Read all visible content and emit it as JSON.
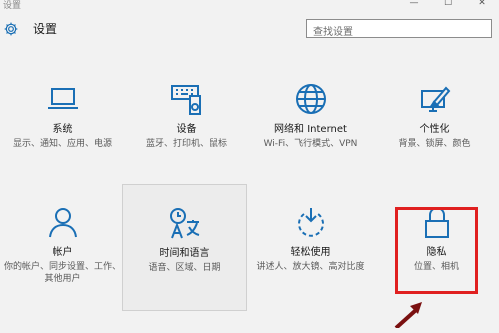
{
  "window": {
    "title": "设置",
    "controls": [
      "—",
      "☐",
      "✕"
    ]
  },
  "header": {
    "icon": "gear-icon",
    "title": "设置"
  },
  "search": {
    "placeholder": "查找设置"
  },
  "tiles": [
    {
      "icon": "laptop-icon",
      "name": "系统",
      "desc": "显示、通知、应用、电源"
    },
    {
      "icon": "keyboard-speaker-icon",
      "name": "设备",
      "desc": "蓝牙、打印机、鼠标"
    },
    {
      "icon": "globe-icon",
      "name": "网络和 Internet",
      "desc": "Wi-Fi、飞行模式、VPN"
    },
    {
      "icon": "paint-monitor-icon",
      "name": "个性化",
      "desc": "背景、锁屏、颜色"
    },
    {
      "icon": "person-icon",
      "name": "帐户",
      "desc": "你的帐户、同步设置、工作、其他用户"
    },
    {
      "icon": "clock-language-icon",
      "name": "时间和语言",
      "desc": "语音、区域、日期"
    },
    {
      "icon": "ease-of-access-icon",
      "name": "轻松使用",
      "desc": "讲述人、放大镜、高对比度"
    },
    {
      "icon": "lock-icon",
      "name": "隐私",
      "desc": "位置、相机"
    }
  ],
  "colors": {
    "accent": "#1a6fb5",
    "highlight": "#e02020",
    "background": "#f2f2f2"
  }
}
